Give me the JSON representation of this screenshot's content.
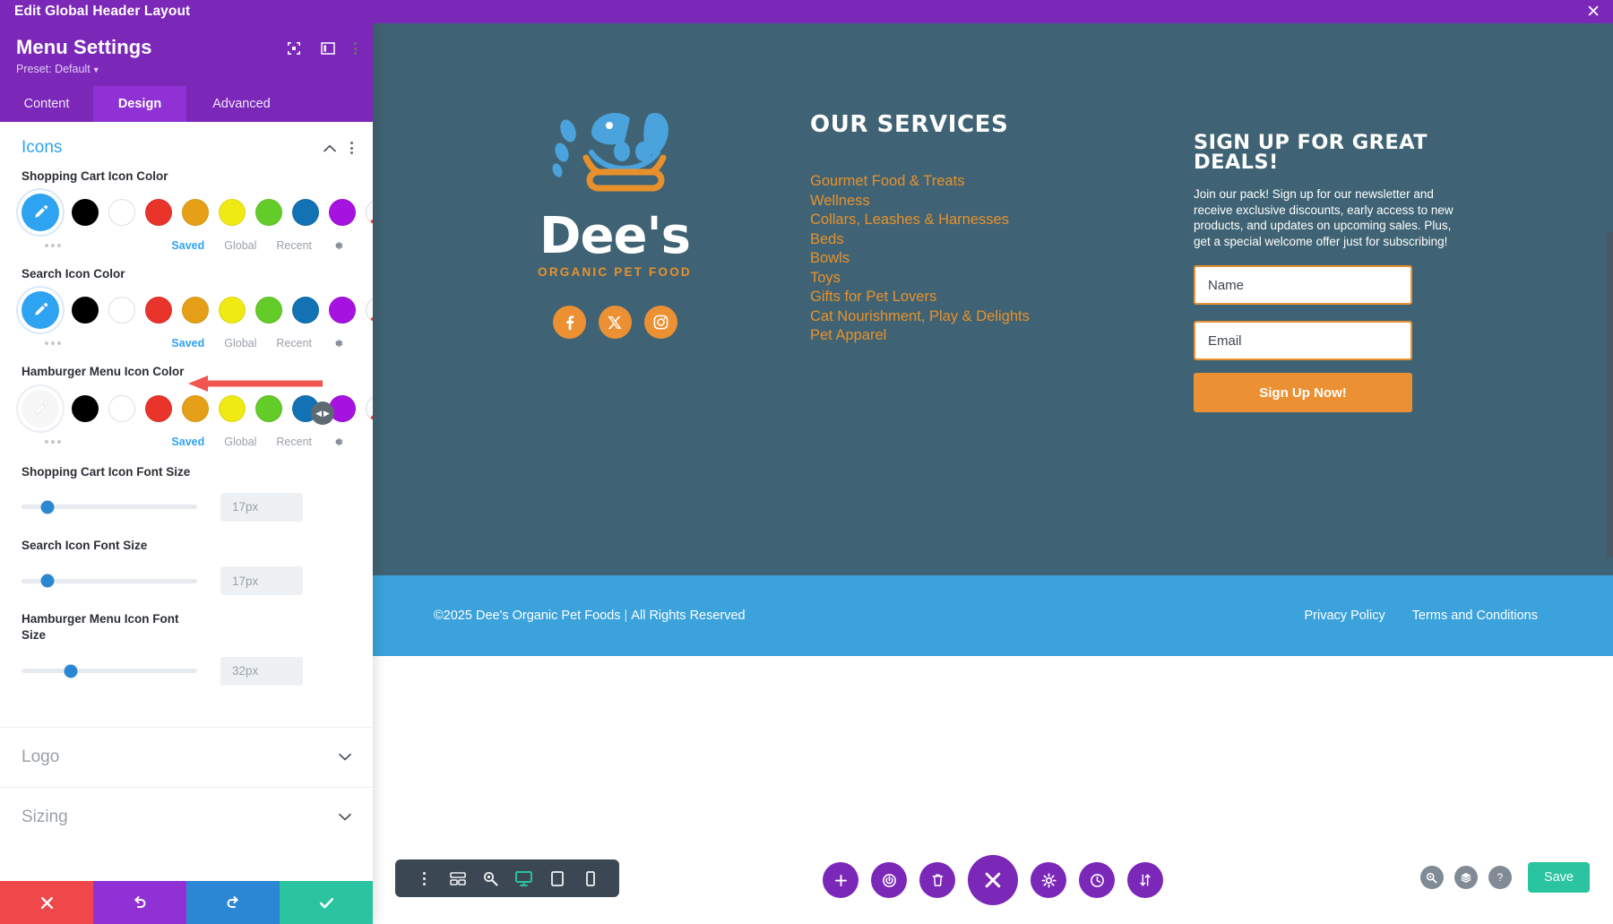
{
  "topbar": {
    "title": "Edit Global Header Layout",
    "close_label": "✕"
  },
  "panel": {
    "title": "Menu Settings",
    "preset_label": "Preset: Default",
    "header_icons": [
      {
        "name": "focus-icon"
      },
      {
        "name": "layout-toggle-icon"
      },
      {
        "name": "more-options-icon"
      }
    ],
    "tabs": [
      {
        "label": "Content",
        "active": false
      },
      {
        "label": "Design",
        "active": true
      },
      {
        "label": "Advanced",
        "active": false
      }
    ],
    "section": {
      "title": "Icons",
      "collapse_icon": "chevron-up-icon",
      "menu_icon": "more-options-icon"
    },
    "palette": [
      {
        "name": "black",
        "hex": "#000000"
      },
      {
        "name": "white",
        "hex": "#ffffff"
      },
      {
        "name": "red",
        "hex": "#e8342b"
      },
      {
        "name": "orange",
        "hex": "#e5a017"
      },
      {
        "name": "yellow",
        "hex": "#efe914"
      },
      {
        "name": "green",
        "hex": "#63cc29"
      },
      {
        "name": "blue",
        "hex": "#1372b3"
      },
      {
        "name": "purple",
        "hex": "#a612e0"
      }
    ],
    "swatch_meta": {
      "saved": "Saved",
      "global": "Global",
      "recent": "Recent",
      "gear": "gear-icon"
    },
    "color_fields": [
      {
        "label": "Shopping Cart Icon Color",
        "picker_empty": false
      },
      {
        "label": "Search Icon Color",
        "picker_empty": false
      },
      {
        "label": "Hamburger Menu Icon Color",
        "picker_empty": true,
        "annotated": true
      }
    ],
    "slider_fields": [
      {
        "label": "Shopping Cart Icon Font Size",
        "value": "17px",
        "pos_pct": 15
      },
      {
        "label": "Search Icon Font Size",
        "value": "17px",
        "pos_pct": 15
      },
      {
        "label": "Hamburger Menu Icon Font Size",
        "value": "32px",
        "pos_pct": 28
      }
    ],
    "accordions": [
      {
        "label": "Logo"
      },
      {
        "label": "Sizing"
      }
    ],
    "footer_buttons": [
      {
        "name": "cancel-button",
        "glyph": "✖",
        "color": "#f0484a"
      },
      {
        "name": "undo-button",
        "glyph": "↺",
        "color": "#8f31d4"
      },
      {
        "name": "redo-button",
        "glyph": "↻",
        "color": "#2b87d4"
      },
      {
        "name": "apply-button",
        "glyph": "✔",
        "color": "#2ac4a1"
      }
    ]
  },
  "preview": {
    "bg_color": "#3f6374",
    "accent_orange": "#ec9133",
    "brand": {
      "name": "Dee's",
      "tagline": "ORGANIC PET FOOD"
    },
    "socials": [
      {
        "name": "facebook-icon",
        "glyph": "f"
      },
      {
        "name": "x-twitter-icon",
        "glyph": "X"
      },
      {
        "name": "instagram-icon",
        "glyph": "▢"
      }
    ],
    "services": {
      "title": "our services",
      "items": [
        "Gourmet Food & Treats",
        "Wellness",
        "Collars, Leashes & Harnesses",
        "Beds",
        "Bowls",
        "Toys",
        "Gifts for Pet Lovers",
        "Cat Nourishment, Play & Delights",
        "Pet Apparel"
      ]
    },
    "signup": {
      "title": "Sign up for great deals!",
      "body": "Join our pack! Sign up for our newsletter and receive exclusive discounts, early access to new products, and updates on upcoming sales. Plus, get a special welcome offer just for subscribing!",
      "name_placeholder": "Name",
      "email_placeholder": "Email",
      "button_label": "Sign Up Now!"
    },
    "footer_bar": {
      "copyright_left": "©2025 Dee's Organic Pet Foods",
      "copyright_right": "All Rights Reserved",
      "links": [
        "Privacy Policy",
        "Terms and Conditions"
      ],
      "bg_color": "#3ba2dc"
    }
  },
  "bottombar": {
    "device_buttons": [
      {
        "name": "more-options-icon",
        "active": false
      },
      {
        "name": "wireframe-icon",
        "active": false
      },
      {
        "name": "zoom-icon",
        "active": false
      },
      {
        "name": "desktop-icon",
        "active": true
      },
      {
        "name": "tablet-icon",
        "active": false
      },
      {
        "name": "phone-icon",
        "active": false
      }
    ],
    "center_buttons": [
      {
        "name": "add-button",
        "glyph": "+",
        "big": false
      },
      {
        "name": "power-button",
        "glyph": "⏻",
        "big": false
      },
      {
        "name": "trash-button",
        "glyph": "Ὕ1",
        "big": false
      },
      {
        "name": "close-button",
        "glyph": "✕",
        "big": true
      },
      {
        "name": "settings-button",
        "glyph": "⚙",
        "big": false
      },
      {
        "name": "history-button",
        "glyph": "ὕ7",
        "big": false
      },
      {
        "name": "sort-button",
        "glyph": "⇅",
        "big": false
      }
    ],
    "right_buttons": [
      {
        "name": "search-button",
        "glyph": "⌕"
      },
      {
        "name": "layers-button",
        "glyph": "☰"
      },
      {
        "name": "help-button",
        "glyph": "?"
      }
    ],
    "save_label": "Save"
  }
}
